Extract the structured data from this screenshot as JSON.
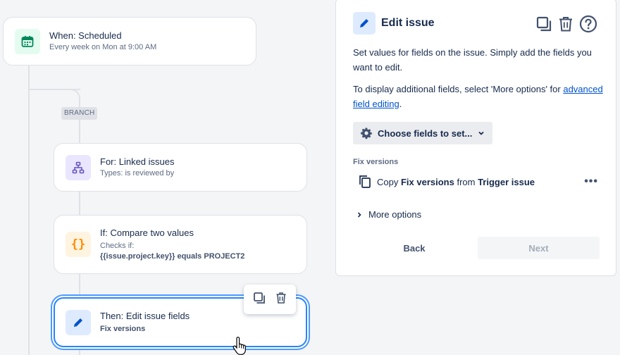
{
  "flow": {
    "trigger": {
      "title": "When: Scheduled",
      "subtitle": "Every week on Mon at 9:00 AM"
    },
    "branch_label": "BRANCH",
    "for_card": {
      "title": "For: Linked issues",
      "subtitle": "Types: is reviewed by"
    },
    "if_card": {
      "title": "If: Compare two values",
      "subtitle": "Checks if:",
      "condition_var": "{{issue.project.key}}",
      "condition_rest": " equals PROJECT2"
    },
    "then_card": {
      "title": "Then: Edit issue fields",
      "subtitle": "Fix versions"
    }
  },
  "panel": {
    "title": "Edit issue",
    "desc1": "Set values for fields on the issue. Simply add the fields you want to edit.",
    "desc2_pre": "To display additional fields, select 'More options' for ",
    "desc2_link": "advanced field editing",
    "desc2_post": ".",
    "choose_label": "Choose fields to set...",
    "field_label": "Fix versions",
    "copy_word": "Copy ",
    "copy_field": "Fix versions",
    "copy_from": " from ",
    "copy_source": "Trigger issue",
    "more_dots": "•••",
    "more_options": "More options",
    "back": "Back",
    "next": "Next"
  },
  "colors": {
    "accent": "#0052cc",
    "selected_border": "#2684ff",
    "trigger_icon": "#00875a",
    "for_icon": "#6554c0",
    "if_icon": "#ff8b00"
  }
}
